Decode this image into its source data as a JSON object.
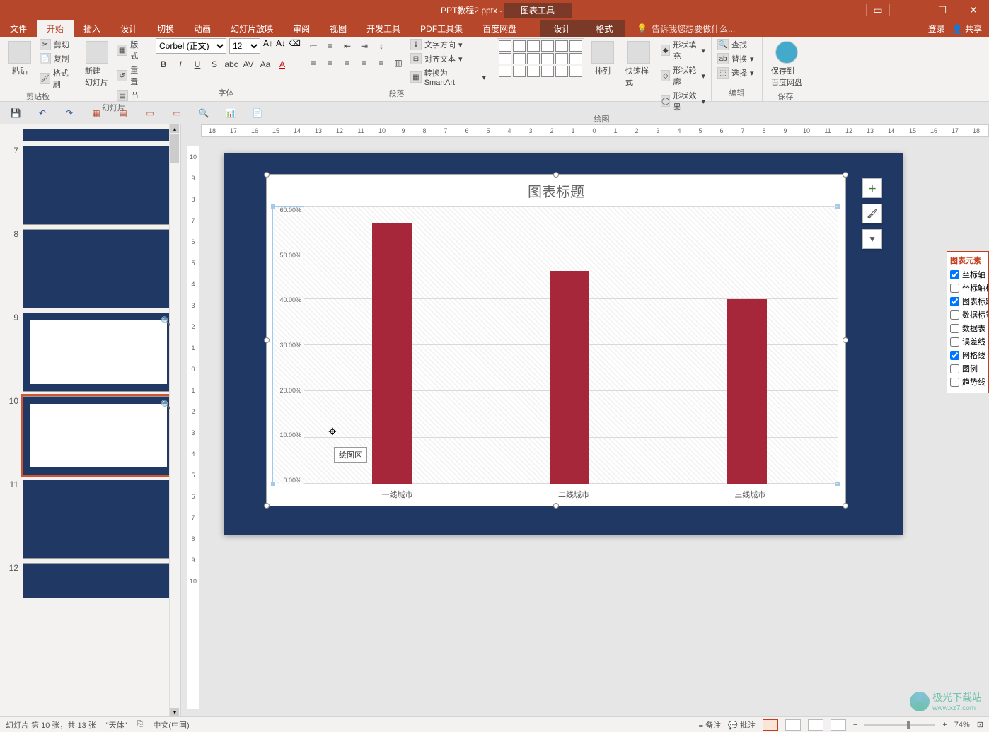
{
  "title_bar": {
    "file_name": "PPT教程2.pptx - PowerPoint",
    "chart_tools": "图表工具"
  },
  "win": {
    "login": "登录",
    "share": "共享"
  },
  "tabs": {
    "file": "文件",
    "home": "开始",
    "insert": "插入",
    "design": "设计",
    "transitions": "切换",
    "animations": "动画",
    "slideshow": "幻灯片放映",
    "review": "审阅",
    "view": "视图",
    "devtools": "开发工具",
    "pdftools": "PDF工具集",
    "baidu": "百度网盘",
    "ctx_design": "设计",
    "ctx_format": "格式",
    "tell_me": "告诉我您想要做什么..."
  },
  "ribbon": {
    "clipboard": {
      "paste": "粘贴",
      "cut": "剪切",
      "copy": "复制",
      "painter": "格式刷",
      "label": "剪贴板"
    },
    "slides": {
      "new_slide": "新建\n幻灯片",
      "layout": "版式",
      "reset": "重置",
      "section": "节",
      "label": "幻灯片"
    },
    "font": {
      "family": "Corbel (正文)",
      "size": "12",
      "label": "字体"
    },
    "paragraph": {
      "text_dir": "文字方向",
      "align_text": "对齐文本",
      "smartart": "转换为 SmartArt",
      "label": "段落"
    },
    "drawing": {
      "arrange": "排列",
      "quick_styles": "快速样式",
      "shape_fill": "形状填充",
      "shape_outline": "形状轮廓",
      "shape_effects": "形状效果",
      "label": "绘图"
    },
    "editing": {
      "find": "查找",
      "replace": "替换",
      "select": "选择",
      "label": "编辑"
    },
    "save_cloud": {
      "save_to": "保存到\n百度网盘",
      "label": "保存"
    }
  },
  "slide_numbers": [
    "7",
    "8",
    "9",
    "10",
    "11",
    "12"
  ],
  "chart_data": {
    "type": "bar",
    "title": "图表标题",
    "categories": [
      "一线城市",
      "二线城市",
      "三线城市"
    ],
    "values": [
      0.565,
      0.46,
      0.4
    ],
    "ylim": [
      0,
      0.6
    ],
    "y_ticks": [
      "0.00%",
      "10.00%",
      "20.00%",
      "30.00%",
      "40.00%",
      "50.00%",
      "60.00%"
    ],
    "xlabel": "",
    "ylabel": ""
  },
  "tooltip": "绘图区",
  "chart_panel": {
    "header": "图表元素",
    "items": [
      {
        "label": "坐标轴",
        "checked": true
      },
      {
        "label": "坐标轴标题",
        "checked": false
      },
      {
        "label": "图表标题",
        "checked": true
      },
      {
        "label": "数据标签",
        "checked": false
      },
      {
        "label": "数据表",
        "checked": false
      },
      {
        "label": "误差线",
        "checked": false
      },
      {
        "label": "网格线",
        "checked": true
      },
      {
        "label": "图例",
        "checked": false
      },
      {
        "label": "趋势线",
        "checked": false
      }
    ]
  },
  "status": {
    "slide_info": "幻灯片 第 10 张，共 13 张",
    "theme": "\"天体\"",
    "lang_icon": "",
    "lang": "中文(中国)",
    "notes": "备注",
    "comments": "批注",
    "zoom": "74%"
  },
  "ruler_h": [
    "18",
    "17",
    "16",
    "15",
    "14",
    "13",
    "12",
    "11",
    "10",
    "9",
    "8",
    "7",
    "6",
    "5",
    "4",
    "3",
    "2",
    "1",
    "0",
    "1",
    "2",
    "3",
    "4",
    "5",
    "6",
    "7",
    "8",
    "9",
    "10",
    "11",
    "12",
    "13",
    "14",
    "15",
    "16",
    "17",
    "18"
  ],
  "ruler_v": [
    "10",
    "9",
    "8",
    "7",
    "6",
    "5",
    "4",
    "3",
    "2",
    "1",
    "0",
    "1",
    "2",
    "3",
    "4",
    "5",
    "6",
    "7",
    "8",
    "9",
    "10"
  ],
  "watermark": {
    "site": "极光下载站",
    "url": "www.xz7.com"
  }
}
